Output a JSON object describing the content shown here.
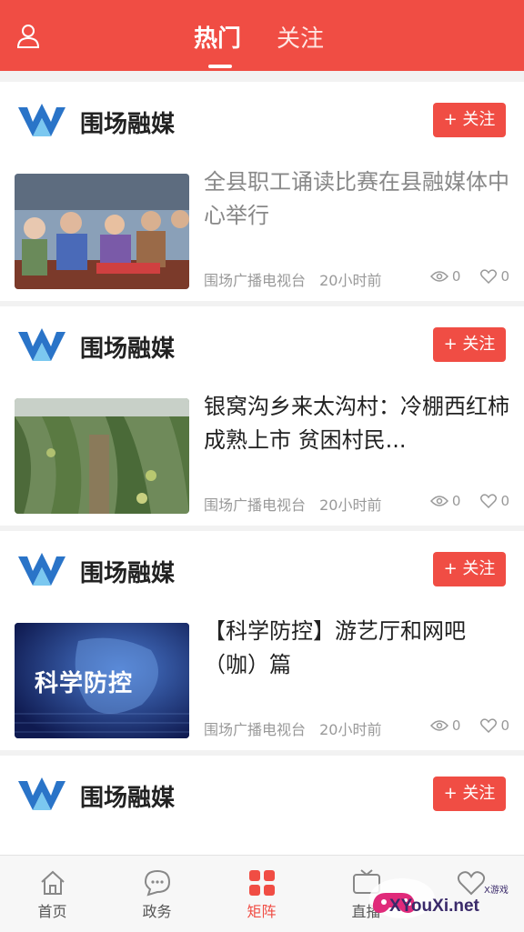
{
  "header": {
    "tabs": [
      {
        "label": "热门",
        "active": true
      },
      {
        "label": "关注",
        "active": false
      }
    ]
  },
  "feed": [
    {
      "source": "围场融媒",
      "follow_label": "+ 关注",
      "title": "全县职工诵读比赛在县融媒体中心举行",
      "title_read": true,
      "publisher": "围场广播电视台",
      "time": "20小时前",
      "views": "0",
      "likes": "0"
    },
    {
      "source": "围场融媒",
      "follow_label": "+ 关注",
      "title": "银窝沟乡来太沟村：冷棚西红柿成熟上市 贫困村民...",
      "title_read": false,
      "publisher": "围场广播电视台",
      "time": "20小时前",
      "views": "0",
      "likes": "0"
    },
    {
      "source": "围场融媒",
      "follow_label": "+ 关注",
      "title": "【科学防控】游艺厅和网吧（咖）篇",
      "title_read": false,
      "thumb_text": "科学防控",
      "publisher": "围场广播电视台",
      "time": "20小时前",
      "views": "0",
      "likes": "0"
    },
    {
      "source": "围场融媒",
      "follow_label": "+ 关注"
    }
  ],
  "bottom_nav": [
    {
      "label": "首页",
      "icon": "home-icon"
    },
    {
      "label": "政务",
      "icon": "chat-icon"
    },
    {
      "label": "矩阵",
      "icon": "grid-icon",
      "active": true
    },
    {
      "label": "直播",
      "icon": "live-icon"
    },
    {
      "label": "",
      "icon": "heart-icon"
    }
  ],
  "watermark": {
    "text": "XYouXi.net",
    "small": "X游戏"
  },
  "colors": {
    "accent": "#f04d44",
    "text": "#222222",
    "muted": "#999999"
  }
}
